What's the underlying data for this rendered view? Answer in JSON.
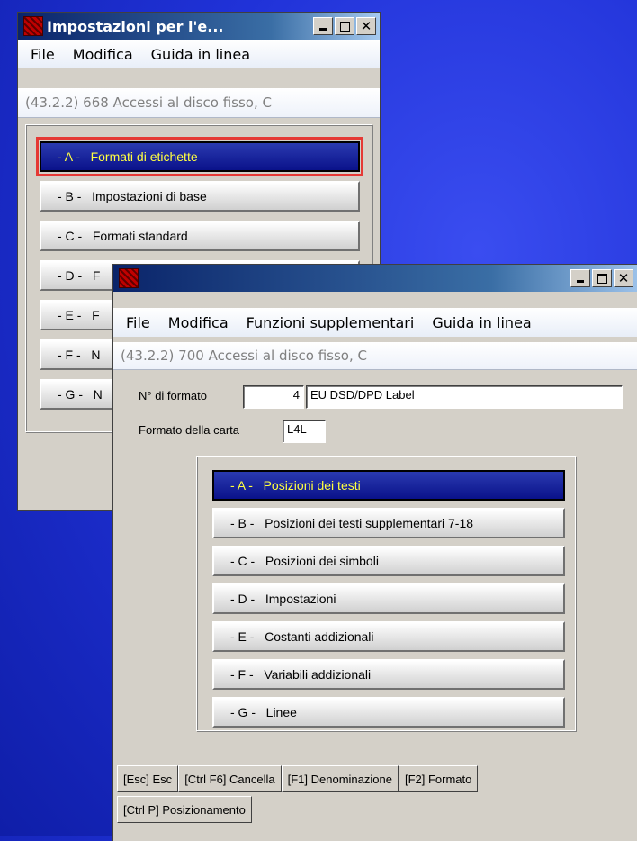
{
  "win1": {
    "title": "Impostazioni per l'e...",
    "menu": [
      "File",
      "Modifica",
      "Guida in linea"
    ],
    "info": "(43.2.2) 668 Accessi al disco fisso, C",
    "buttons": [
      "- A -   Formati di etichette",
      "- B -   Impostazioni di base",
      "- C -   Formati standard",
      "- D -   F",
      "- E -   F",
      "- F -   N",
      "- G -   N"
    ],
    "selected": 0
  },
  "win2": {
    "title": "",
    "menu": [
      "File",
      "Modifica",
      "Funzioni supplementari",
      "Guida in linea"
    ],
    "info": "(43.2.2) 700 Accessi al disco fisso, C",
    "format_label": "N° di formato",
    "format_number": "4",
    "format_name": "EU DSD/DPD Label",
    "paper_label": "Formato della carta",
    "paper_value": "L4L",
    "buttons": [
      "- A -   Posizioni dei testi",
      "- B -   Posizioni dei testi supplementari 7-18",
      "- C -   Posizioni dei simboli",
      "- D -   Impostazioni",
      "- E -   Costanti addizionali",
      "- F -   Variabili addizionali",
      "- G -   Linee"
    ],
    "selected": 0,
    "fkeys_row1": [
      "[Esc] Esc",
      "[Ctrl F6] Cancella",
      "[F1] Denominazione",
      "[F2] Formato"
    ],
    "fkeys_row2": [
      "[Ctrl P] Posizionamento"
    ]
  },
  "colors": {
    "selected_bg": "#0a128a",
    "selected_text": "#ffff40",
    "highlight": "#e53935"
  }
}
